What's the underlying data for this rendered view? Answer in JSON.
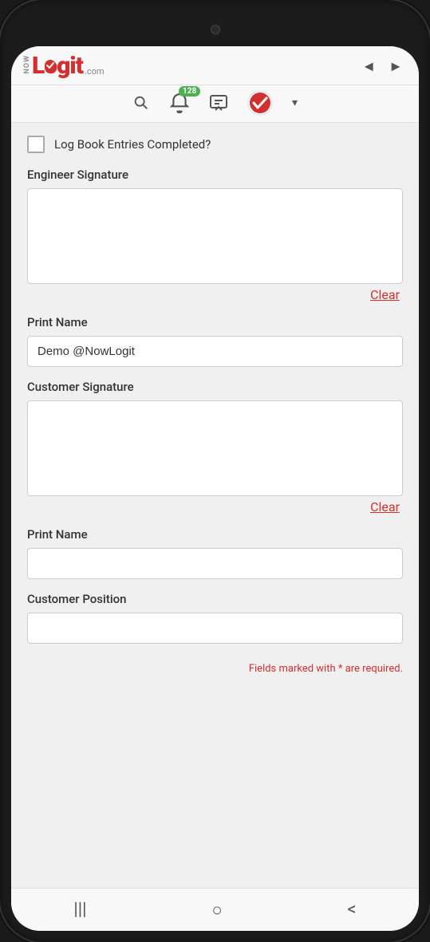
{
  "header": {
    "logo_now": "NOW",
    "logo_logit": "Logit",
    "logo_com": ".com",
    "nav_back_label": "◄",
    "nav_forward_label": "►"
  },
  "toolbar": {
    "badge_count": "128",
    "dropdown_arrow": "▾",
    "icons": {
      "search": "search-icon",
      "bell": "bell-icon",
      "chat": "chat-icon",
      "brand": "brand-check-icon"
    }
  },
  "form": {
    "logbook_label": "Log Book Entries Completed?",
    "engineer_signature_label": "Engineer Signature",
    "engineer_clear_label": "Clear",
    "print_name_label": "Print Name",
    "print_name_value": "Demo @NowLogit",
    "print_name_placeholder": "",
    "customer_signature_label": "Customer Signature",
    "customer_clear_label": "Clear",
    "customer_print_name_label": "Print Name",
    "customer_print_name_value": "",
    "customer_position_label": "Customer Position",
    "customer_position_value": "",
    "required_note": "Fields marked with ",
    "required_asterisk": "*",
    "required_note_end": " are required."
  },
  "bottom_nav": {
    "menu_icon": "|||",
    "home_icon": "○",
    "back_icon": "<"
  }
}
